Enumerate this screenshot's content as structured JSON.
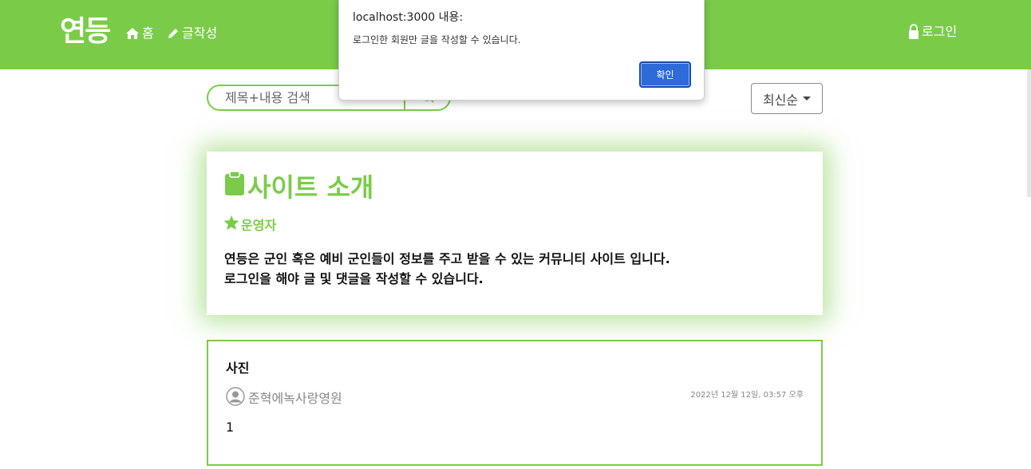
{
  "nav": {
    "logo": "연등",
    "home_label": "홈",
    "write_label": "글작성",
    "login_label": "로그인"
  },
  "search": {
    "placeholder": "제목+내용 검색"
  },
  "sort": {
    "selected": "최신순"
  },
  "intro": {
    "title": "사이트 소개",
    "author": "운영자",
    "line1": "연등은 군인 혹은 예비 군인들이 정보를 주고 받을 수 있는 커뮤니티 사이트 입니다.",
    "line2": "로그인을 해야 글 및 댓글을 작성할 수 있습니다."
  },
  "posts": [
    {
      "title": "사진",
      "author": "준혁에녹사랑영원",
      "date": "2022년 12월 12일, 03:57 오후",
      "body": "1"
    }
  ],
  "alert": {
    "origin": "localhost:3000 내용:",
    "message": "로그인한 회원만 글을 작성할 수 있습니다.",
    "ok_label": "확인"
  },
  "colors": {
    "brand_green": "#7acc48",
    "alert_button": "#2c6bd8"
  }
}
